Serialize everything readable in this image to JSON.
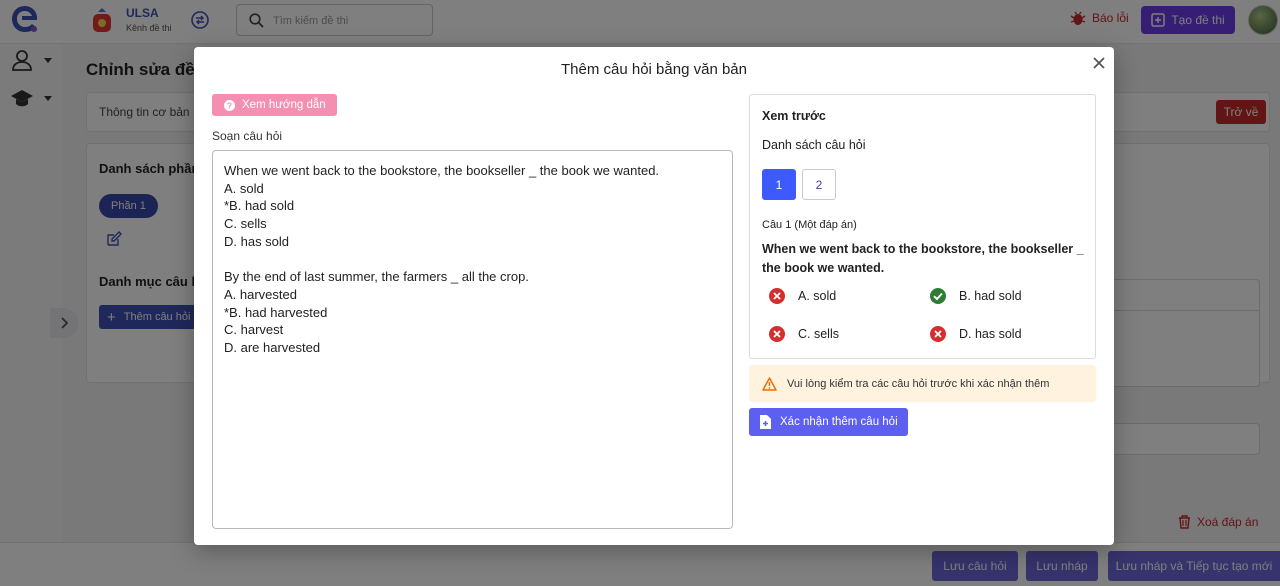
{
  "header": {
    "brand_name": "ULSA",
    "brand_sub": "Kênh đề thi",
    "search_placeholder": "Tìm kiếm đề thi",
    "report_label": "Báo lỗi",
    "create_label": "Tạo đề thi"
  },
  "page": {
    "title": "Chỉnh sửa đề thi",
    "info_tab": "Thông tin cơ bản",
    "back_label": "Trở về",
    "sections_title": "Danh sách phần",
    "part_chip": "Phần 1",
    "category_title": "Danh mục câu hỏi",
    "add_question_label": "Thêm câu hỏi",
    "delete_answer_label": "Xoá đáp án"
  },
  "footer": {
    "save_question": "Lưu câu hỏi",
    "save_draft": "Lưu nháp",
    "save_continue": "Lưu nháp và Tiếp tục tạo mới"
  },
  "modal": {
    "title": "Thêm câu hỏi bằng văn bản",
    "guide_label": "Xem hướng dẫn",
    "compose_label": "Soạn câu hỏi",
    "editor_lines": [
      "When we went back to the bookstore, the bookseller _ the book we wanted.",
      "A. sold",
      "*B. had sold",
      "C. sells",
      "D. has sold",
      "",
      "By the end of last summer, the farmers _ all the crop.",
      "A. harvested",
      "*B. had harvested",
      "C. harvest",
      "D. are harvested"
    ],
    "preview": {
      "title": "Xem trước",
      "list_label": "Danh sách câu hỏi",
      "pages": [
        "1",
        "2"
      ],
      "active_page": "1",
      "question_meta": "Câu 1 (Một đáp án)",
      "question_text": "When we went back to the bookstore, the bookseller _ the book we wanted.",
      "options": [
        {
          "label": "A. sold",
          "correct": false
        },
        {
          "label": "B. had sold",
          "correct": true
        },
        {
          "label": "C. sells",
          "correct": false
        },
        {
          "label": "D. has sold",
          "correct": false
        }
      ]
    },
    "warning": "Vui lòng kiểm tra các câu hỏi trước khi xác nhận thêm",
    "confirm_label": "Xác nhận thêm câu hỏi"
  },
  "colors": {
    "primary": "#3d5afe",
    "accent_purple": "#6a3de8",
    "danger": "#c62828",
    "success": "#2e7d32",
    "guide_pink": "#f48fb1",
    "warning_bg": "#fff3e0"
  }
}
